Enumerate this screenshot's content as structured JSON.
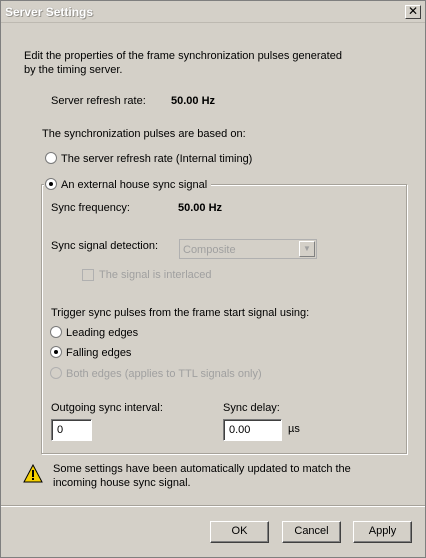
{
  "window": {
    "title": "Server Settings",
    "close_glyph": "✕"
  },
  "description": {
    "line1": "Edit the properties of the frame synchronization pulses generated",
    "line2": "by the timing server."
  },
  "refresh": {
    "label": "Server refresh rate:",
    "value": "50.00 Hz"
  },
  "pulses_based_label": "The synchronization pulses are based on:",
  "timing_source": {
    "internal_label": "The server refresh rate (Internal timing)",
    "external_label": "An external house sync signal",
    "selected": "external"
  },
  "external": {
    "sync_freq_label": "Sync frequency:",
    "sync_freq_value": "50.00 Hz",
    "detection_label": "Sync signal detection:",
    "detection_value": "Composite",
    "interlaced_label": "The signal is interlaced",
    "interlaced_checked": false,
    "trigger_label": "Trigger sync pulses from the frame start signal using:",
    "edges": {
      "leading": "Leading edges",
      "falling": "Falling edges",
      "both": "Both edges (applies to TTL signals only)",
      "selected": "falling"
    },
    "outgoing_label": "Outgoing sync interval:",
    "outgoing_value": "0",
    "delay_label": "Sync delay:",
    "delay_value": "0.00",
    "delay_unit": "µs"
  },
  "warning": {
    "icon": "warning-icon",
    "line1": "Some settings have been automatically updated to match the",
    "line2": "incoming house sync signal."
  },
  "buttons": {
    "ok": "OK",
    "cancel": "Cancel",
    "apply": "Apply"
  }
}
